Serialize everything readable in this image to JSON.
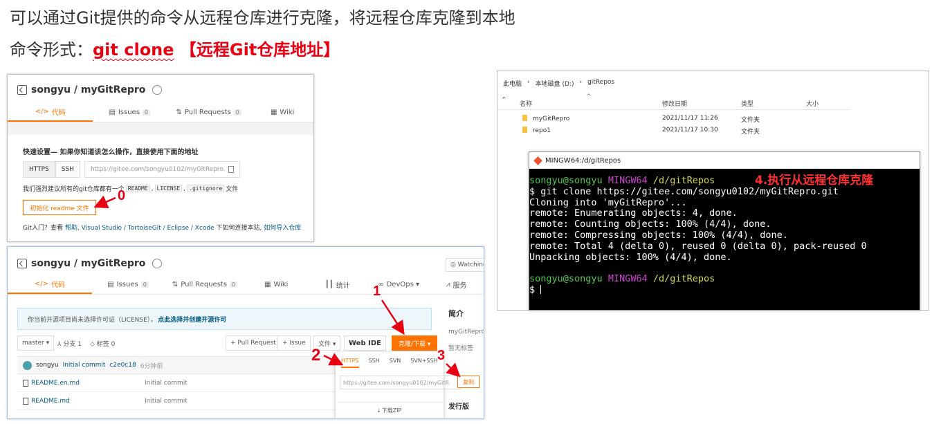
{
  "headings": {
    "line1": "可以通过Git提供的命令从远程仓库进行克隆，将远程仓库克隆到本地",
    "line2_prefix": "命令形式：",
    "line2_cmd": "git clone",
    "line2_arg": " 【远程Git仓库地址】"
  },
  "panel1": {
    "repo_title": "songyu / myGitRepro",
    "tabs": [
      {
        "icon": "</>",
        "label": "代码"
      },
      {
        "icon": "▤",
        "label": "Issues",
        "count": "0"
      },
      {
        "icon": "⇅",
        "label": "Pull Requests",
        "count": "0"
      },
      {
        "icon": "▦",
        "label": "Wiki"
      }
    ],
    "quick_setup": "快速设置— 如果你知道该怎么操作，直接使用下面的地址",
    "proto_https": "HTTPS",
    "proto_ssh": "SSH",
    "url": "https://gitee.com/songyu0102/myGitRepro.",
    "suggest_prefix": "我们强烈建议所有的git仓库都有一个",
    "chip_readme": "README",
    "chip_license": "LICENSE",
    "chip_gitignore": ".gitignore",
    "suggest_suffix": "文件",
    "sep": ",",
    "init_button": "初始化 readme 文件",
    "help_prefix": "Git入门？查看 ",
    "help_link1": "帮助",
    "help_mid": ", ",
    "help_link2": "Visual Studio / TortoiseGit / Eclipse / Xcode",
    "help_mid2": " 下如何连接本站, ",
    "help_link3": "如何导入仓库"
  },
  "panel2": {
    "repo_title": "songyu / myGitRepro",
    "watch": "◎ Watching",
    "tabs": [
      {
        "icon": "</>",
        "label": "代码"
      },
      {
        "icon": "▤",
        "label": "Issues",
        "count": "0"
      },
      {
        "icon": "⇅",
        "label": "Pull Requests",
        "count": "0"
      },
      {
        "icon": "▦",
        "label": "Wiki"
      },
      {
        "icon": "┃┃",
        "label": "统计"
      },
      {
        "icon": "∞",
        "label": "DevOps ▾"
      },
      {
        "icon": "⩘",
        "label": "服务"
      }
    ],
    "license_text": "你当前开源项目尚未选择许可证（LICENSE），",
    "license_link": "点此选择并创建开源许可",
    "branch": "master ▾",
    "branches": "⅄ 分支 1",
    "tags": "◇ 标签 0",
    "pull_request": "+ Pull Request",
    "issue": "+ Issue",
    "file_menu": "文件 ▾",
    "web_ide": "Web IDE",
    "clone_button": "克隆/下载 ▾",
    "commit": {
      "author": "songyu",
      "message": "Initial commit",
      "hash": "c2e0c18",
      "time": "6分钟前"
    },
    "files": [
      {
        "name": "README.en.md",
        "message": "Initial commit"
      },
      {
        "name": "README.md",
        "message": "Initial commit"
      }
    ],
    "dropdown": {
      "tabs": [
        "HTTPS",
        "SSH",
        "SVN",
        "SVN+SSH"
      ],
      "url": "https://gitee.com/songyu0102/myGitR",
      "copy": "复制",
      "zip": "⤓ 下载ZIP"
    },
    "side": {
      "title": "简介",
      "repo": "myGitRepro",
      "tags": "暂无标签",
      "more": "发行版"
    }
  },
  "annotations": {
    "n0": "0",
    "n1": "1",
    "n2": "2",
    "n3": "3"
  },
  "explorer": {
    "crumbs": [
      "此电脑",
      "›",
      "本地磁盘 (D:)",
      "›",
      "gitRepos"
    ],
    "columns": {
      "name": "名称",
      "date": "修改日期",
      "type": "类型",
      "size": "大小"
    },
    "sort_arrow": "^",
    "scroll_up": "^",
    "rows": [
      {
        "name": "myGitRepro",
        "date": "2021/11/17 11:26",
        "type": "文件夹"
      },
      {
        "name": "repo1",
        "date": "2021/11/17 10:30",
        "type": "文件夹"
      }
    ]
  },
  "terminal": {
    "title": "MINGW64:/d/gitRepos",
    "user": "songyu@songyu",
    "host": "MINGW64",
    "path": "/d/gitRepos",
    "annotation": "4.执行从远程仓库克隆",
    "lines": [
      "$ git clone https://gitee.com/songyu0102/myGitRepro.git",
      "Cloning into 'myGitRepro'...",
      "remote: Enumerating objects: 4, done.",
      "remote: Counting objects: 100% (4/4), done.",
      "remote: Compressing objects: 100% (4/4), done.",
      "remote: Total 4 (delta 0), reused 0 (delta 0), pack-reused 0",
      "Unpacking objects: 100% (4/4), done."
    ],
    "prompt": "$ "
  },
  "colors": {
    "accent": "#fe7300",
    "red": "#e60012",
    "link": "#005980"
  }
}
